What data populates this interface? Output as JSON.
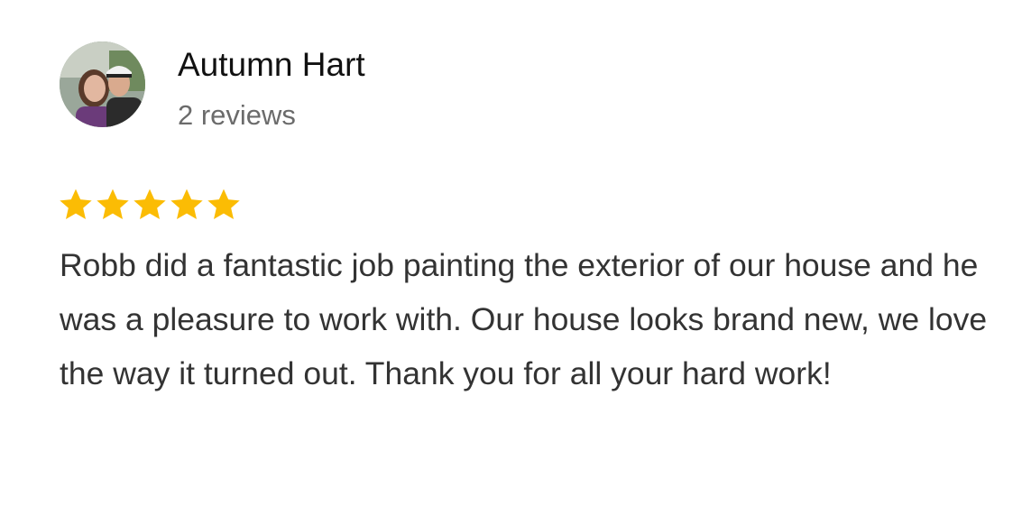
{
  "reviewer": {
    "name": "Autumn Hart",
    "review_count": "2 reviews",
    "avatar": "profile-photo"
  },
  "rating": {
    "value": 5,
    "max": 5,
    "star_color": "#FBBC04"
  },
  "review": {
    "text": "Robb did a fantastic job painting the exterior of our house and he was a pleasure to work with. Our house looks brand new, we love the way it turned out. Thank you for all your hard work!"
  },
  "colors": {
    "name": "#111111",
    "meta": "#6b6b6b",
    "body": "#333333",
    "background": "#ffffff"
  }
}
